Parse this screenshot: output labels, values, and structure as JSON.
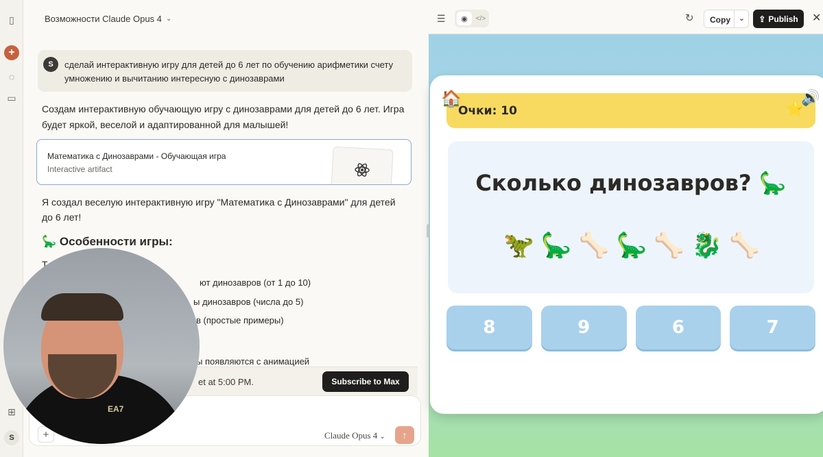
{
  "rail": {
    "new_chat_icon": "plus-icon",
    "user_initial": "S"
  },
  "chat": {
    "title": "Возможности Claude Opus 4",
    "user_message": {
      "avatar": "S",
      "text": "сделай интерактивную игру для детей до 6 лет по обучению арифметики счету умножению и вычитанию интересную с динозаврами"
    },
    "response_intro": "Создам интерактивную обучающую игру с динозаврами для детей до 6 лет. Игра будет яркой, веселой и адаптированной для малышей!",
    "artifact": {
      "title": "Математика с Динозаврами - Обучающая игра",
      "subtitle": "Interactive artifact"
    },
    "response_body": "Я создал веселую интерактивную игру \"Математика с Динозаврами\" для детей до 6 лет!",
    "features_heading": "🦕 Особенности игры:",
    "features_partial_t": "Т",
    "features": [
      "ют динозавров (от 1 до 10)",
      "ы динозавров (числа до 5)",
      "в (простые примеры)",
      "ы появляются с анимацией"
    ],
    "limit_text": "et at 5:00 PM.",
    "subscribe_label": "Subscribe to Max",
    "composer": {
      "model_label": "Claude Opus 4"
    }
  },
  "webcam": {
    "shirt_logo": "EA7"
  },
  "panel": {
    "toolbar": {
      "copy_label": "Copy",
      "publish_label": "Publish"
    },
    "game": {
      "score_label": "Очки: 10",
      "question": "Сколько динозавров? 🦕",
      "items": [
        "🦖",
        "🦕",
        "🦴",
        "🦕",
        "🦴",
        "🐉",
        "🦴"
      ],
      "answers": [
        "8",
        "9",
        "6",
        "7"
      ]
    }
  }
}
